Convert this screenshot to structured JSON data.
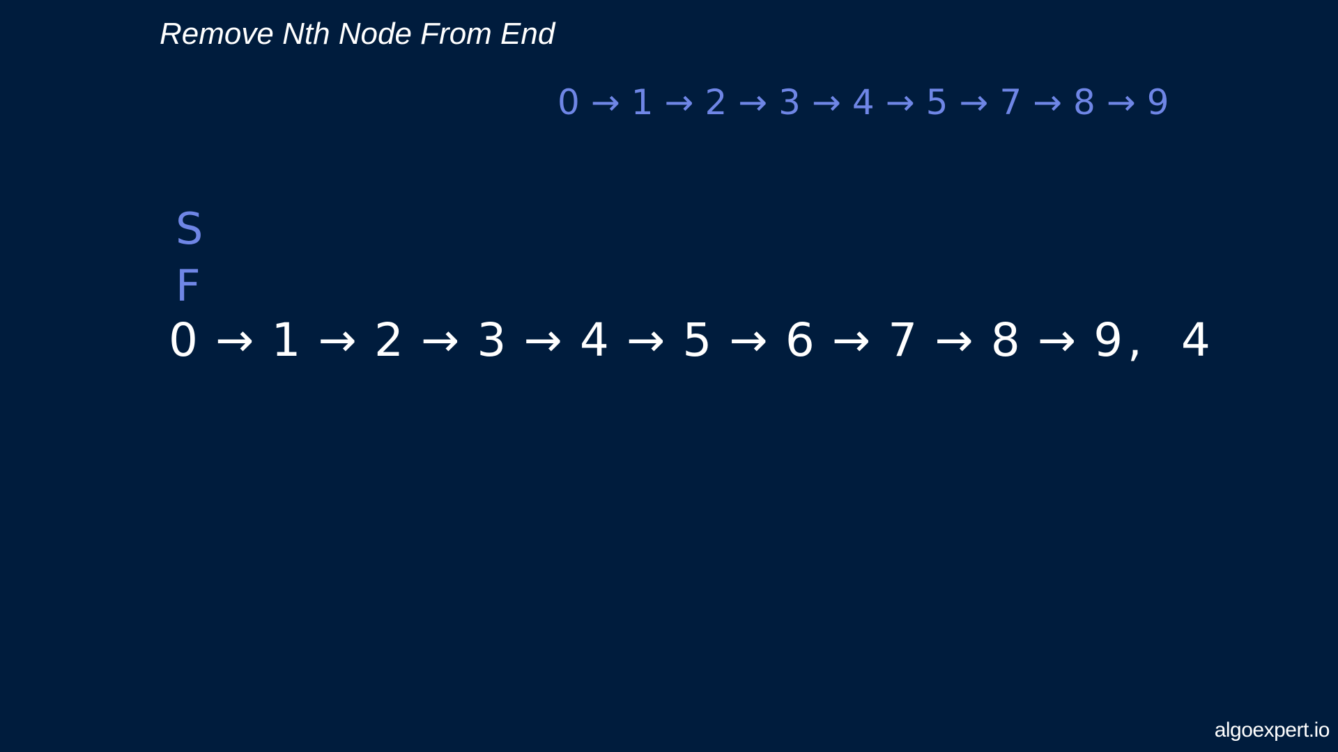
{
  "title": "Remove Nth Node From End",
  "colors": {
    "background": "#001c3d",
    "ink_white": "#ffffff",
    "ink_blue": "#6f86e6"
  },
  "top_list": {
    "nodes": [
      "0",
      "1",
      "2",
      "3",
      "4",
      "5",
      "7",
      "8",
      "9"
    ],
    "arrow": "→"
  },
  "pointers": {
    "slow": "S",
    "fast": "F"
  },
  "main_list": {
    "nodes": [
      "0",
      "1",
      "2",
      "3",
      "4",
      "5",
      "6",
      "7",
      "8",
      "9"
    ],
    "arrow": "→",
    "separator": ",",
    "n_value": "4"
  },
  "watermark": "algoexpert.io"
}
